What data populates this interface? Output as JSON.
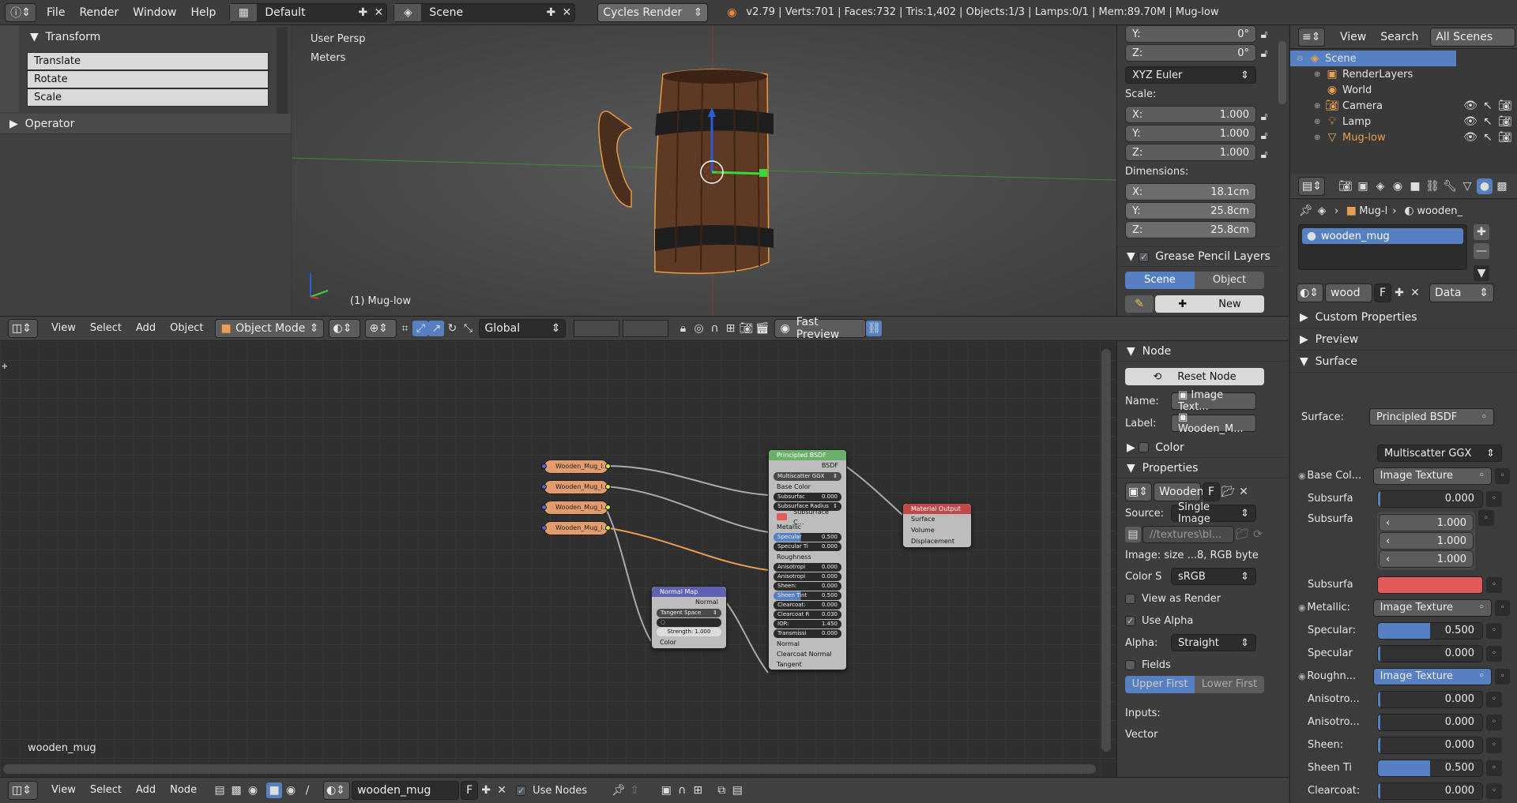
{
  "topbar": {
    "menus": [
      "File",
      "Render",
      "Window",
      "Help"
    ],
    "layout": "Default",
    "scene": "Scene",
    "engine": "Cycles Render",
    "stats": "v2.79 | Verts:701 | Faces:732 | Tris:1,402 | Objects:1/3 | Lamps:0/1 | Mem:89.70M | Mug-low"
  },
  "toolpanel": {
    "transform_title": "Transform",
    "buttons": [
      "Translate",
      "Rotate",
      "Scale"
    ],
    "operator_title": "Operator"
  },
  "viewport": {
    "view_label": "User Persp",
    "units_label": "Meters",
    "object_label": "(1) Mug-low"
  },
  "npanel": {
    "rot_y": "0°",
    "rot_z": "0°",
    "rotation_mode": "XYZ Euler",
    "scale_label": "Scale:",
    "scale": [
      {
        "axis": "X:",
        "value": "1.000"
      },
      {
        "axis": "Y:",
        "value": "1.000"
      },
      {
        "axis": "Z:",
        "value": "1.000"
      }
    ],
    "dimensions_label": "Dimensions:",
    "dimensions": [
      {
        "axis": "X:",
        "value": "18.1cm"
      },
      {
        "axis": "Y:",
        "value": "25.8cm"
      },
      {
        "axis": "Z:",
        "value": "25.8cm"
      }
    ],
    "grease_title": "Grease Pencil Layers",
    "tab_scene": "Scene",
    "tab_object": "Object",
    "new_label": "New"
  },
  "view3d_header": {
    "menus": [
      "View",
      "Select",
      "Add",
      "Object"
    ],
    "mode": "Object Mode",
    "orientation": "Global",
    "preview": "Fast Preview"
  },
  "outliner": {
    "menus": [
      "View",
      "Search"
    ],
    "scope": "All Scenes",
    "items": [
      {
        "label": "Scene",
        "indent": 0,
        "selected": true
      },
      {
        "label": "RenderLayers",
        "indent": 1
      },
      {
        "label": "World",
        "indent": 1
      },
      {
        "label": "Camera",
        "indent": 1
      },
      {
        "label": "Lamp",
        "indent": 1
      },
      {
        "label": "Mug-low",
        "indent": 1,
        "orange": true
      }
    ]
  },
  "props": {
    "crumbs": [
      "Mug-l",
      "wooden_"
    ],
    "material_slot": "wooden_mug",
    "material_name": "wood",
    "f_label": "F",
    "data_label": "Data",
    "sections": [
      "Custom Properties",
      "Preview",
      "Surface"
    ],
    "surface_label": "Surface:",
    "surface_value": "Principled BSDF",
    "distribution": "Multiscatter GGX",
    "rows": [
      {
        "label": "Base Col...",
        "type": "sel",
        "value": "Image Texture",
        "dot": true
      },
      {
        "label": "Subsurfa",
        "type": "bar",
        "value": "0.000",
        "fill": 0
      },
      {
        "label": "Subsurfa",
        "type": "vec",
        "values": [
          "1.000",
          "1.000",
          "1.000"
        ]
      },
      {
        "label": "Subsurfa",
        "type": "color",
        "color": "#e05a5a"
      },
      {
        "label": "Metallic:",
        "type": "sel",
        "value": "Image Texture",
        "dot": true
      },
      {
        "label": "Specular:",
        "type": "bar",
        "value": "0.500",
        "fill": 0.5
      },
      {
        "label": "Specular",
        "type": "bar",
        "value": "0.000",
        "fill": 0
      },
      {
        "label": "Roughn...",
        "type": "sel",
        "value": "Image Texture",
        "dot": true,
        "highlight": true
      },
      {
        "label": "Anisotro...",
        "type": "bar",
        "value": "0.000",
        "fill": 0
      },
      {
        "label": "Anisotro...",
        "type": "bar",
        "value": "0.000",
        "fill": 0
      },
      {
        "label": "Sheen:",
        "type": "bar",
        "value": "0.000",
        "fill": 0
      },
      {
        "label": "Sheen Ti",
        "type": "bar",
        "value": "0.500",
        "fill": 0.5
      },
      {
        "label": "Clearcoat:",
        "type": "bar",
        "value": "0.000",
        "fill": 0
      }
    ]
  },
  "nodepanel": {
    "node_title": "Node",
    "reset": "Reset Node",
    "name_label": "Name:",
    "name_value": "Image Text...",
    "label_label": "Label:",
    "label_value": "Wooden_M...",
    "color_title": "Color",
    "properties_title": "Properties",
    "image_name": "Wooden",
    "f_label": "F",
    "source_label": "Source:",
    "source_value": "Single Image",
    "path": "//textures\\bl...",
    "image_info": "Image: size ...8, RGB byte",
    "colorspace_label": "Color S",
    "colorspace_value": "sRGB",
    "view_as_render": "View as Render",
    "use_alpha": "Use Alpha",
    "alpha_label": "Alpha:",
    "alpha_value": "Straight",
    "fields": "Fields",
    "upper_first": "Upper First",
    "lower_first": "Lower First",
    "inputs": "Inputs:",
    "vector": "Vector"
  },
  "nodes": {
    "textures": [
      "Wooden_Mug_l...",
      "Wooden_Mug_l...",
      "Wooden_Mug_l...",
      "Wooden_Mug_l..."
    ],
    "bsdf": {
      "title": "Principled BSDF",
      "out": "BSDF",
      "dist": "Multiscatter GGX",
      "rows": [
        {
          "t": "label",
          "v": "Base Color"
        },
        {
          "t": "field",
          "l": "Subsurfac",
          "v": "0.000"
        },
        {
          "t": "field",
          "l": "Subsurface Radius",
          "v": "↕"
        },
        {
          "t": "color",
          "l": "Subsurface C..."
        },
        {
          "t": "label",
          "v": "Metallic"
        },
        {
          "t": "blue",
          "l": "Specular",
          "v": "0.500"
        },
        {
          "t": "field",
          "l": "Specular Ti",
          "v": "0.000"
        },
        {
          "t": "label",
          "v": "Roughness"
        },
        {
          "t": "field",
          "l": "Anisotropi",
          "v": "0.000"
        },
        {
          "t": "field",
          "l": "Anisotropi",
          "v": "0.000"
        },
        {
          "t": "field",
          "l": "Sheen:",
          "v": "0.000"
        },
        {
          "t": "blue",
          "l": "Sheen Tint",
          "v": "0.500"
        },
        {
          "t": "field",
          "l": "Clearcoat:",
          "v": "0.000"
        },
        {
          "t": "field",
          "l": "Clearcoat R",
          "v": "0.030"
        },
        {
          "t": "field",
          "l": "IOR:",
          "v": "1.450"
        },
        {
          "t": "field",
          "l": "Transmissi",
          "v": "0.000"
        },
        {
          "t": "label",
          "v": "Normal"
        },
        {
          "t": "label",
          "v": "Clearcoat Normal"
        },
        {
          "t": "label",
          "v": "Tangent"
        }
      ]
    },
    "output": {
      "title": "Material Output",
      "rows": [
        "Surface",
        "Volume",
        "Displacement"
      ]
    },
    "normalmap": {
      "title": "Normal Map",
      "out": "Normal",
      "space": "Tangent Space",
      "strength_label": "Strength:",
      "strength": "1.000",
      "color": "Color"
    },
    "material_label": "wooden_mug"
  },
  "bottombar": {
    "menus": [
      "View",
      "Select",
      "Add",
      "Node"
    ],
    "material": "wooden_mug",
    "f_label": "F",
    "use_nodes": "Use Nodes"
  }
}
